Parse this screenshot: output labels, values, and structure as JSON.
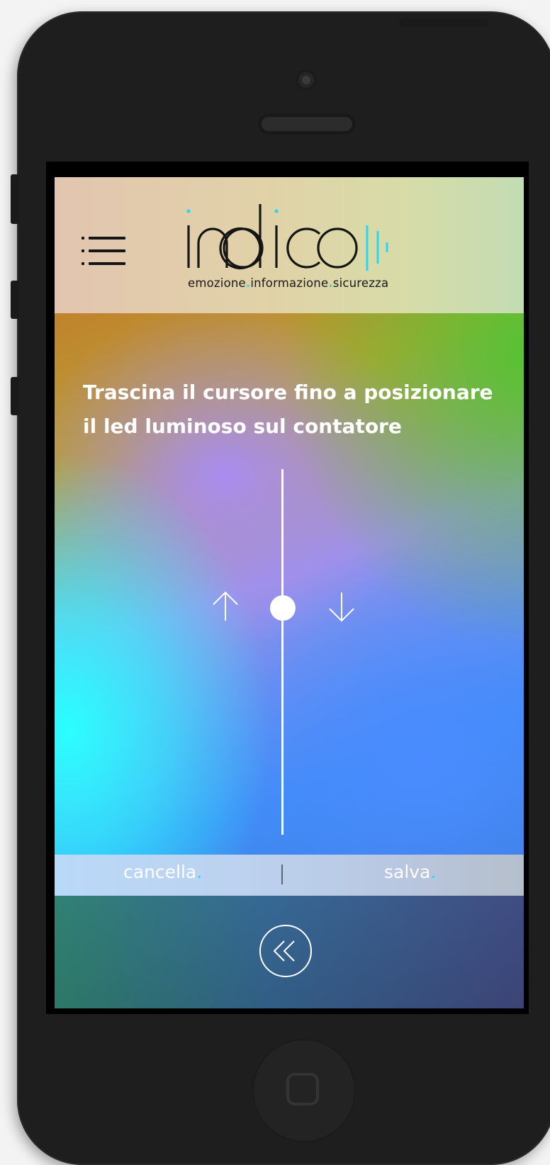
{
  "header": {
    "menu_icon": "hamburger-menu-icon",
    "logo_text": "indico",
    "tagline": {
      "part1": "emozione",
      "part2": "informazione",
      "part3": "sicurezza",
      "separator": "."
    }
  },
  "instruction": {
    "line1": "Trascina il cursore fino a posizionare",
    "line2": "il led luminoso sul contatore"
  },
  "slider": {
    "up_icon": "arrow-up-icon",
    "down_icon": "arrow-down-icon",
    "position": 0.38
  },
  "actions": {
    "cancel_label": "cancella",
    "save_label": "salva",
    "dot": "."
  },
  "back_button": {
    "icon": "double-chevron-left-icon"
  },
  "colors": {
    "accent": "#2ad6f0",
    "text_dark": "#151515",
    "text_light": "#ffffff"
  }
}
